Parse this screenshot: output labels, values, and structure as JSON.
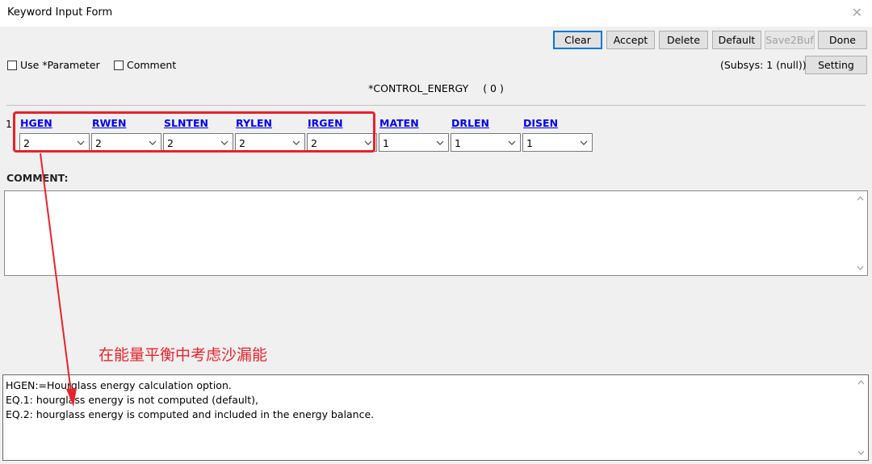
{
  "window": {
    "title": "Keyword Input Form"
  },
  "toolbar": {
    "clear": "Clear",
    "accept": "Accept",
    "delete": "Delete",
    "default": "Default",
    "save2buf": "Save2Buf",
    "done": "Done",
    "setting": "Setting"
  },
  "options": {
    "use_parameter": "Use *Parameter",
    "comment": "Comment"
  },
  "subsys": "(Subsys: 1 (null))",
  "keyword": {
    "name": "*CONTROL_ENERGY",
    "index": "( 0 )"
  },
  "card": {
    "row_number": "1",
    "fields": [
      {
        "label": "HGEN",
        "value": "2"
      },
      {
        "label": "RWEN",
        "value": "2"
      },
      {
        "label": "SLNTEN",
        "value": "2"
      },
      {
        "label": "RYLEN",
        "value": "2"
      },
      {
        "label": "IRGEN",
        "value": "2"
      },
      {
        "label": "MATEN",
        "value": "1"
      },
      {
        "label": "DRLEN",
        "value": "1"
      },
      {
        "label": "DISEN",
        "value": "1"
      }
    ]
  },
  "comment_section": {
    "label": "COMMENT:",
    "text": ""
  },
  "annotation": {
    "text": "在能量平衡中考虑沙漏能",
    "color": "#e8222c"
  },
  "help": {
    "lines": [
      "HGEN:=Hourglass energy calculation option.",
      "EQ.1: hourglass energy is not computed (default),",
      "EQ.2: hourglass energy is computed and included in the energy balance."
    ]
  },
  "colors": {
    "accent": "#0078d7",
    "link": "#0000ee",
    "highlight": "#e8222c"
  }
}
